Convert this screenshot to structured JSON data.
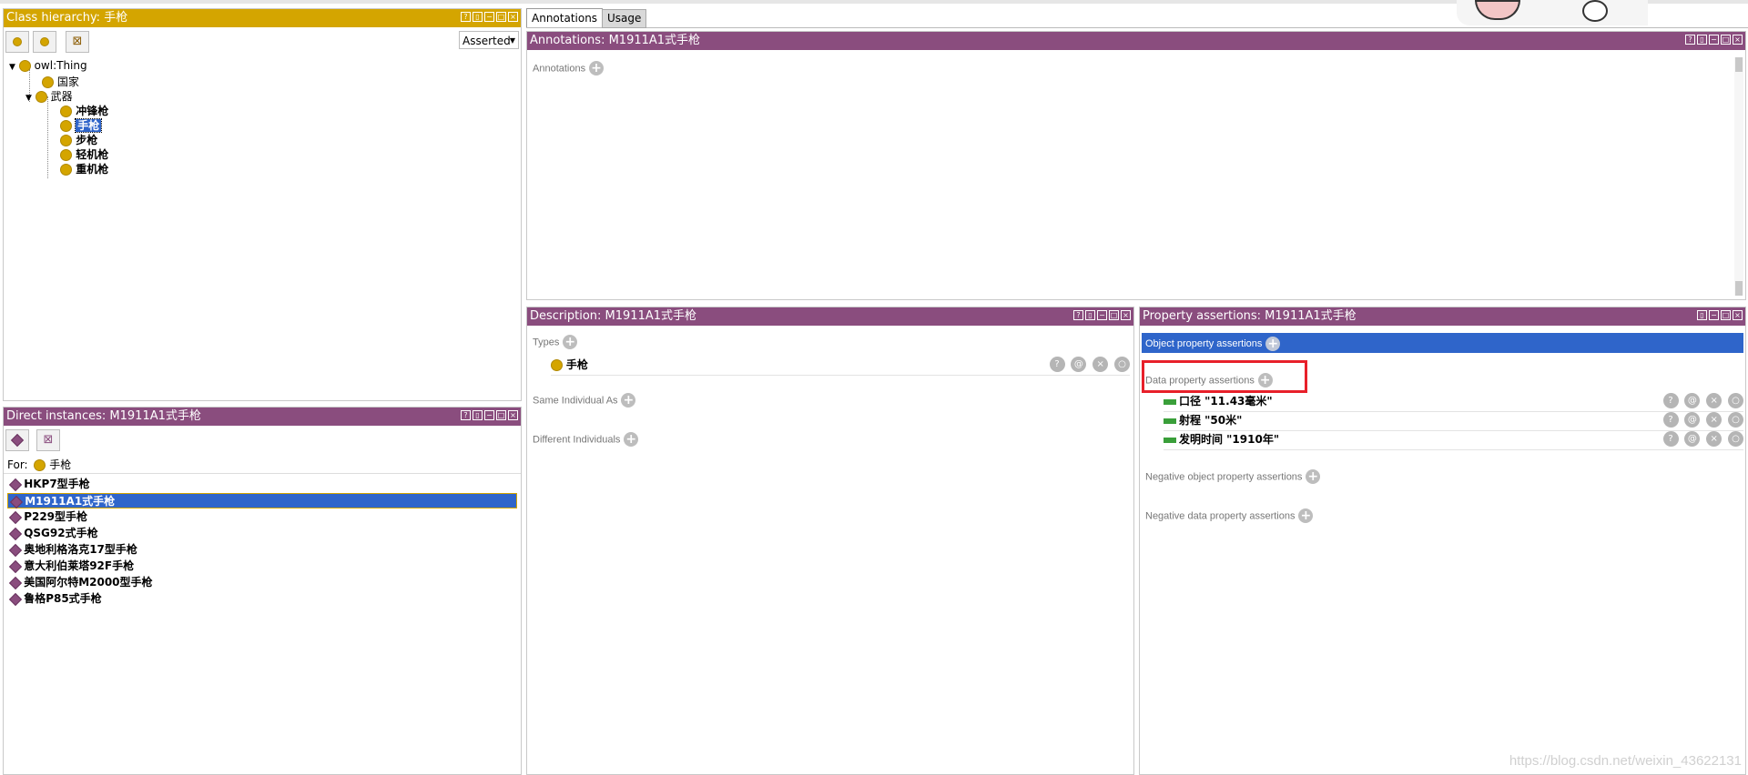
{
  "class_hierarchy": {
    "title": "Class hierarchy: 手枪",
    "mode": "Asserted",
    "tree": {
      "root": "owl:Thing",
      "level1": [
        "国家",
        "武器"
      ],
      "weapons": [
        "冲锋枪",
        "手枪",
        "步枪",
        "轻机枪",
        "重机枪"
      ]
    }
  },
  "tabs": [
    "Annotations",
    "Usage"
  ],
  "annotations_panel": {
    "title": "Annotations: M1911A1式手枪",
    "section_label": "Annotations"
  },
  "direct_instances": {
    "title": "Direct instances: M1911A1式手枪",
    "for_label": "For:",
    "for_class": "手枪",
    "items": [
      "HKP7型手枪",
      "M1911A1式手枪",
      "P229型手枪",
      "QSG92式手枪",
      "奥地利格洛克17型手枪",
      "意大利伯莱塔92F手枪",
      "美国阿尔特M2000型手枪",
      "鲁格P85式手枪"
    ]
  },
  "description": {
    "title": "Description: M1911A1式手枪",
    "types_label": "Types",
    "type_value": "手枪",
    "same_label": "Same Individual As",
    "different_label": "Different Individuals"
  },
  "property_assertions": {
    "title": "Property assertions: M1911A1式手枪",
    "object_label": "Object property assertions",
    "data_label": "Data property assertions",
    "data_items": [
      "口径  \"11.43毫米\"",
      "射程  \"50米\"",
      "发明时间  \"1910年\""
    ],
    "neg_object_label": "Negative object property assertions",
    "neg_data_label": "Negative data property assertions"
  },
  "watermark": "https://blog.csdn.net/weixin_43622131",
  "colors": {
    "gold": "#d4a500",
    "purple": "#8a4d7e",
    "selection": "#2f65ca",
    "highlight_box": "#e8202a"
  }
}
